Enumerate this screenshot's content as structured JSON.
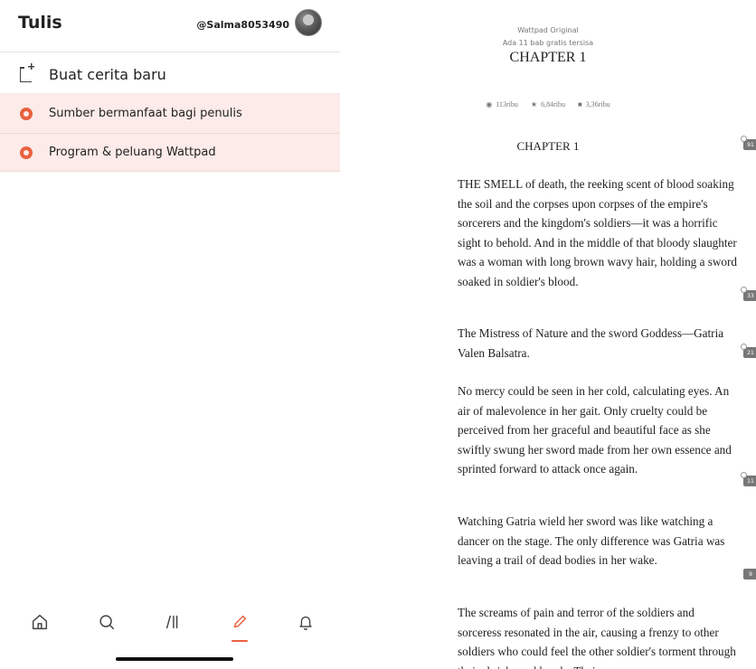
{
  "left": {
    "header": {
      "title": "Tulis",
      "username": "@Salma8053490"
    },
    "menu": {
      "new_story": "Buat cerita baru",
      "resources": "Sumber bermanfaat bagi penulis",
      "programs": "Program & peluang Wattpad"
    },
    "bottom_nav": [
      "home-icon",
      "search-icon",
      "library-icon",
      "write-icon",
      "notifications-icon"
    ],
    "accent_color": "#e8613f",
    "highlight_bg": "#fcebe8"
  },
  "reader": {
    "label_original": "Wattpad Original",
    "label_free_chapters": "Ada 11 bab gratis tersisa",
    "chapter_header": "CHAPTER 1",
    "stats": {
      "reads": "113ribu",
      "votes": "6,84ribu",
      "comments": "3,36ribu"
    },
    "chapter_subtitle": "CHAPTER 1",
    "paragraphs": [
      "THE SMELL of death, the reeking scent of blood soaking the soil and the corpses upon corpses of the empire's sorcerers and the kingdom's soldiers—it was a horrific sight to behold. And in the middle of that bloody slaughter was a woman with long brown wavy hair, holding a sword soaked in soldier's blood.",
      "The Mistress of Nature and the sword Goddess—Gatria Valen Balsatra.",
      "No mercy could be seen in her cold, calculating eyes. An air of malevolence in her gait. Only cruelty could be perceived from her graceful and beautiful face as she swiftly swung her sword made from her own essence and sprinted forward to attack once again.",
      "Watching Gatria wield her sword was like watching a dancer on the stage. The only difference was Gatria was leaving a trail of dead bodies in her wake.",
      "The screams of pain and terror of the soldiers and sorceress resonated in the air, causing a frenzy to other soldiers who could feel the other soldier's torment through their shrieks and howls. Their"
    ],
    "comment_counts": {
      "subtitle": "91",
      "p1": "33",
      "p2": "21",
      "p3": "11",
      "p4": "9"
    }
  }
}
